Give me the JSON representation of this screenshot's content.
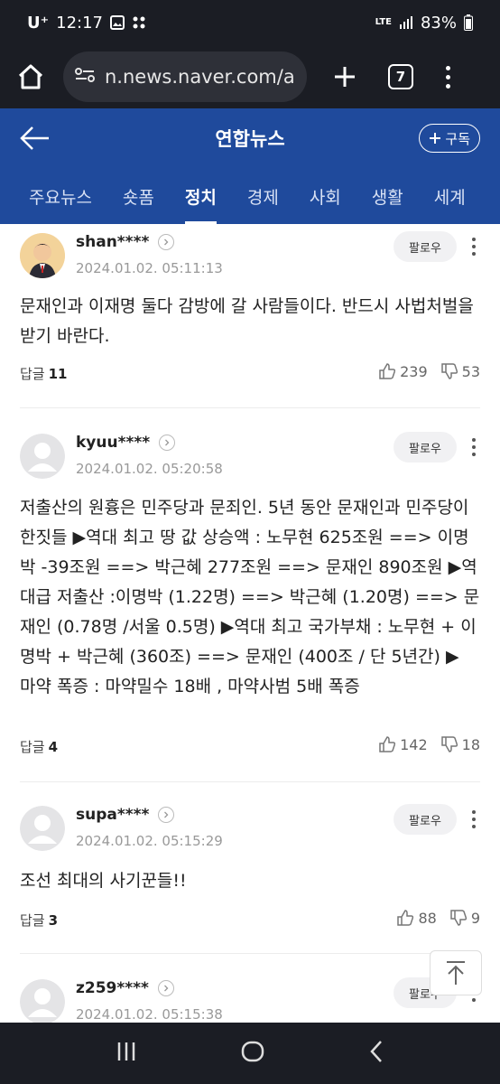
{
  "status_bar": {
    "carrier": "U⁺",
    "time": "12:17",
    "network": "LTE",
    "battery": "83%"
  },
  "browser": {
    "url": "n.news.naver.com/ar",
    "tab_count": "7"
  },
  "header": {
    "title": "연합뉴스",
    "subscribe_label": "구독"
  },
  "categories": [
    "주요뉴스",
    "숏폼",
    "정치",
    "경제",
    "사회",
    "생활",
    "세계"
  ],
  "active_category": "정치",
  "comments": [
    {
      "username": "shan****",
      "timestamp": "2024.01.02. 05:11:13",
      "follow_label": "팔로우",
      "text": "문재인과 이재명 둘다 감방에 갈 사람들이다. 반드시 사법처벌을 받기 바란다.",
      "reply_label": "답글",
      "reply_count": "11",
      "likes": "239",
      "dislikes": "53"
    },
    {
      "username": "kyuu****",
      "timestamp": "2024.01.02. 05:20:58",
      "follow_label": "팔로우",
      "text": "저출산의 원흉은 민주당과 문죄인. 5년 동안 문재인과 민주당이 한짓들 ▶역대 최고 땅 값 상승액 : 노무현 625조원 ==> 이명박 -39조원 ==> 박근혜 277조원 ==> 문재인 890조원 ▶역대급 저출산 :이명박 (1.22명) ==> 박근혜 (1.20명) ==> 문재인 (0.78명 /서울 0.5명) ▶역대 최고 국가부채 : 노무현 + 이명박 + 박근혜 (360조) ==> 문재인 (400조 / 단 5년간) ▶ 마약 폭증 : 마약밀수 18배 , 마약사범 5배 폭증",
      "reply_label": "답글",
      "reply_count": "4",
      "likes": "142",
      "dislikes": "18"
    },
    {
      "username": "supa****",
      "timestamp": "2024.01.02. 05:15:29",
      "follow_label": "팔로우",
      "text": "조선 최대의 사기꾼들!!",
      "reply_label": "답글",
      "reply_count": "3",
      "likes": "88",
      "dislikes": "9"
    },
    {
      "username": "z259****",
      "timestamp": "2024.01.02. 05:15:38",
      "follow_label": "팔로우"
    }
  ],
  "colors": {
    "system_bar": "#1b1d24",
    "header_blue": "#1f4a9c"
  }
}
